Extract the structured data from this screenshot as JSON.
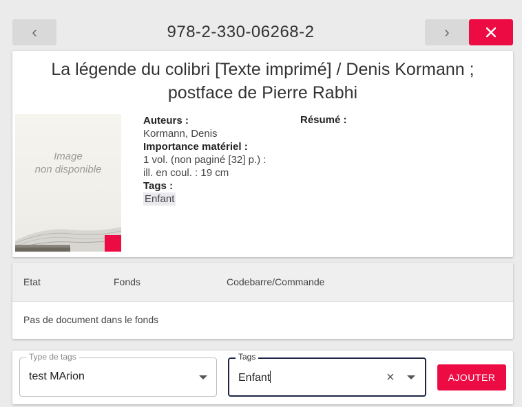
{
  "header": {
    "isbn": "978-2-330-06268-2",
    "prev_icon": "‹",
    "next_icon": "›"
  },
  "book": {
    "title": "La légende du colibri [Texte imprimé] / Denis Kormann ; postface de Pierre Rabhi",
    "cover_placeholder_line1": "Image",
    "cover_placeholder_line2": "non disponible",
    "authors_label": "Auteurs :",
    "authors_value": "Kormann, Denis",
    "material_label": "Importance matériel :",
    "material_line1": "1 vol. (non paginé [32] p.) :",
    "material_line2": "ill. en coul. : 19 cm",
    "tags_label": "Tags :",
    "tags_value": "Enfant",
    "resume_label": "Résumé :"
  },
  "fonds": {
    "columns": [
      "Etat",
      "Fonds",
      "Codebarre/Commande"
    ],
    "empty_message": "Pas de document dans le fonds"
  },
  "form": {
    "type_label": "Type de tags",
    "type_value": "test MArion",
    "tags_label": "Tags",
    "tags_value": "Enfant",
    "add_label": "AJOUTER"
  },
  "colors": {
    "accent": "#ec0b43",
    "focus_border": "#1f2445",
    "background": "#ebebeb"
  }
}
